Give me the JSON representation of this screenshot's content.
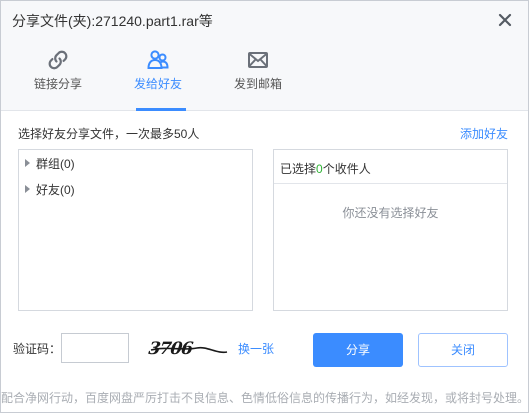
{
  "dialog": {
    "title": "分享文件(夹):271240.part1.rar等"
  },
  "icons": {
    "close": "close-icon",
    "link": "link-icon",
    "friends": "friends-icon",
    "mail": "mail-icon",
    "tree_arrow": "caret-right-icon"
  },
  "tabs": [
    {
      "label": "链接分享",
      "active": false
    },
    {
      "label": "发给好友",
      "active": true
    },
    {
      "label": "发到邮箱",
      "active": false
    }
  ],
  "friends": {
    "instruction": "选择好友分享文件，一次最多50人",
    "add_friend_label": "添加好友",
    "tree": [
      {
        "label": "群组(0)"
      },
      {
        "label": "好友(0)"
      }
    ],
    "selected_prefix": "已选择",
    "selected_count": "0",
    "selected_suffix": "个收件人",
    "empty_message": "你还没有选择好友"
  },
  "captcha": {
    "label": "验证码：",
    "input_value": "",
    "image_text": "3706",
    "change_label": "换一张"
  },
  "buttons": {
    "share": "分享",
    "close": "关闭"
  },
  "notice": "配合净网行动，百度网盘严厉打击不良信息、色情低俗信息的传播行为，如经发现，或将封号处理。",
  "colors": {
    "accent": "#3b8cff",
    "count_green": "#2fb335",
    "muted_text": "#a9adb3"
  }
}
